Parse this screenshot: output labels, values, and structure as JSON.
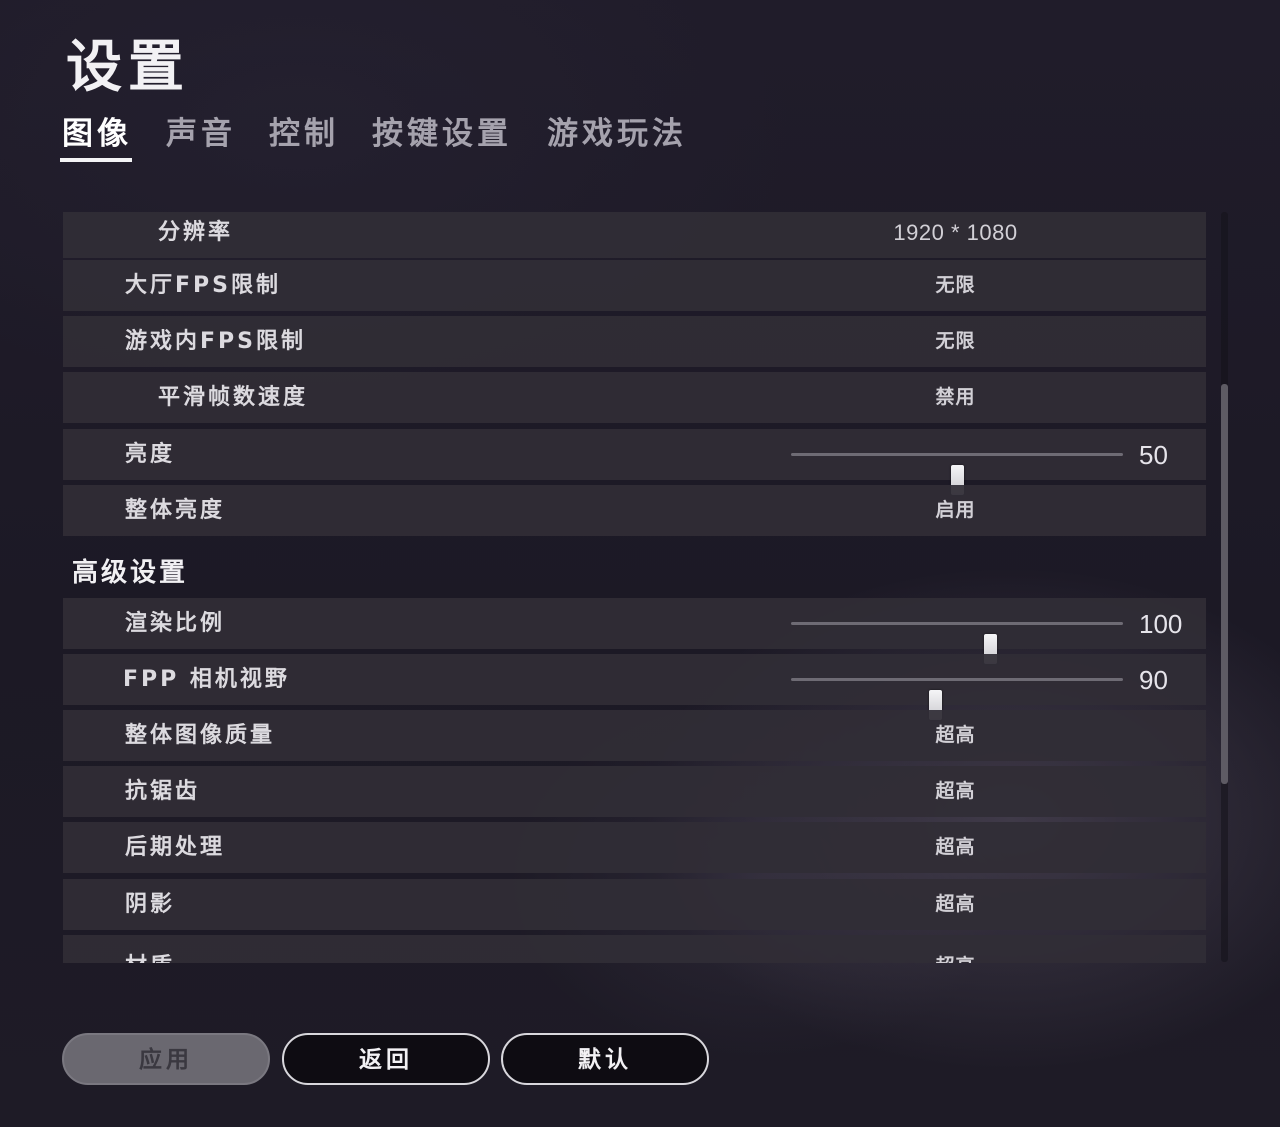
{
  "page": {
    "title": "设置"
  },
  "tabs": [
    {
      "label": "图像",
      "active": true
    },
    {
      "label": "声音"
    },
    {
      "label": "控制"
    },
    {
      "label": "按键设置"
    },
    {
      "label": "游戏玩法"
    }
  ],
  "settings": {
    "resolution": {
      "label": "分辨率",
      "value": "1920 * 1080"
    },
    "lobby_fps": {
      "label": "大厅FPS限制",
      "value": "无限"
    },
    "ingame_fps": {
      "label": "游戏内FPS限制",
      "value": "无限"
    },
    "smooth_framerate": {
      "label": "平滑帧数速度",
      "value": "禁用"
    },
    "brightness": {
      "label": "亮度",
      "value": "50",
      "min": 0,
      "max": 100
    },
    "overall_brightness": {
      "label": "整体亮度",
      "value": "启用"
    }
  },
  "advanced": {
    "header": "高级设置",
    "render_scale": {
      "label": "渲染比例",
      "value": "100",
      "min": 70,
      "max": 120
    },
    "fpp_fov": {
      "label": "FPP 相机视野",
      "value": "90",
      "min": 80,
      "max": 103
    },
    "overall_quality": {
      "label": "整体图像质量",
      "value": "超高"
    },
    "anti_aliasing": {
      "label": "抗锯齿",
      "value": "超高"
    },
    "post_processing": {
      "label": "后期处理",
      "value": "超高"
    },
    "shadows": {
      "label": "阴影",
      "value": "超高"
    },
    "textures": {
      "label": "材质",
      "value": "超高"
    }
  },
  "buttons": {
    "apply": "应用",
    "back": "返回",
    "default": "默认"
  }
}
